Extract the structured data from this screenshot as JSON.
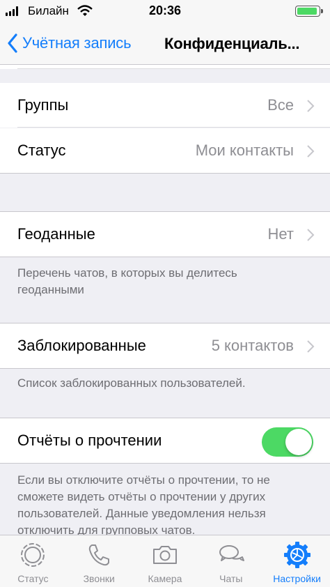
{
  "status_bar": {
    "carrier": "Билайн",
    "time": "20:36",
    "battery_level": 1.0,
    "battery_color": "#4cd964"
  },
  "nav": {
    "back_label": "Учётная запись",
    "title": "Конфиденциаль..."
  },
  "rows": {
    "groups": {
      "label": "Группы",
      "value": "Все"
    },
    "status": {
      "label": "Статус",
      "value": "Мои контакты"
    },
    "location": {
      "label": "Геоданные",
      "value": "Нет",
      "footer": "Перечень чатов, в которых вы делитесь геоданными"
    },
    "blocked": {
      "label": "Заблокированные",
      "value": "5 контактов",
      "footer": "Список заблокированных пользователей."
    },
    "read_receipts": {
      "label": "Отчёты о прочтении",
      "enabled": true,
      "footer": "Если вы отключите отчёты о прочтении, то не сможете видеть отчёты о прочтении у других пользователей. Данные уведомления нельзя отключить для групповых чатов."
    }
  },
  "tabs": [
    {
      "label": "Статус",
      "icon": "status-icon",
      "active": false
    },
    {
      "label": "Звонки",
      "icon": "phone-icon",
      "active": false
    },
    {
      "label": "Камера",
      "icon": "camera-icon",
      "active": false
    },
    {
      "label": "Чаты",
      "icon": "chats-icon",
      "active": false
    },
    {
      "label": "Настройки",
      "icon": "settings-gear-icon",
      "active": true
    }
  ],
  "colors": {
    "accent": "#147efb",
    "toggle_on": "#4cd964",
    "secondary_text": "#8e8e93",
    "footer_text": "#6d6d72",
    "background": "#efeff4"
  }
}
